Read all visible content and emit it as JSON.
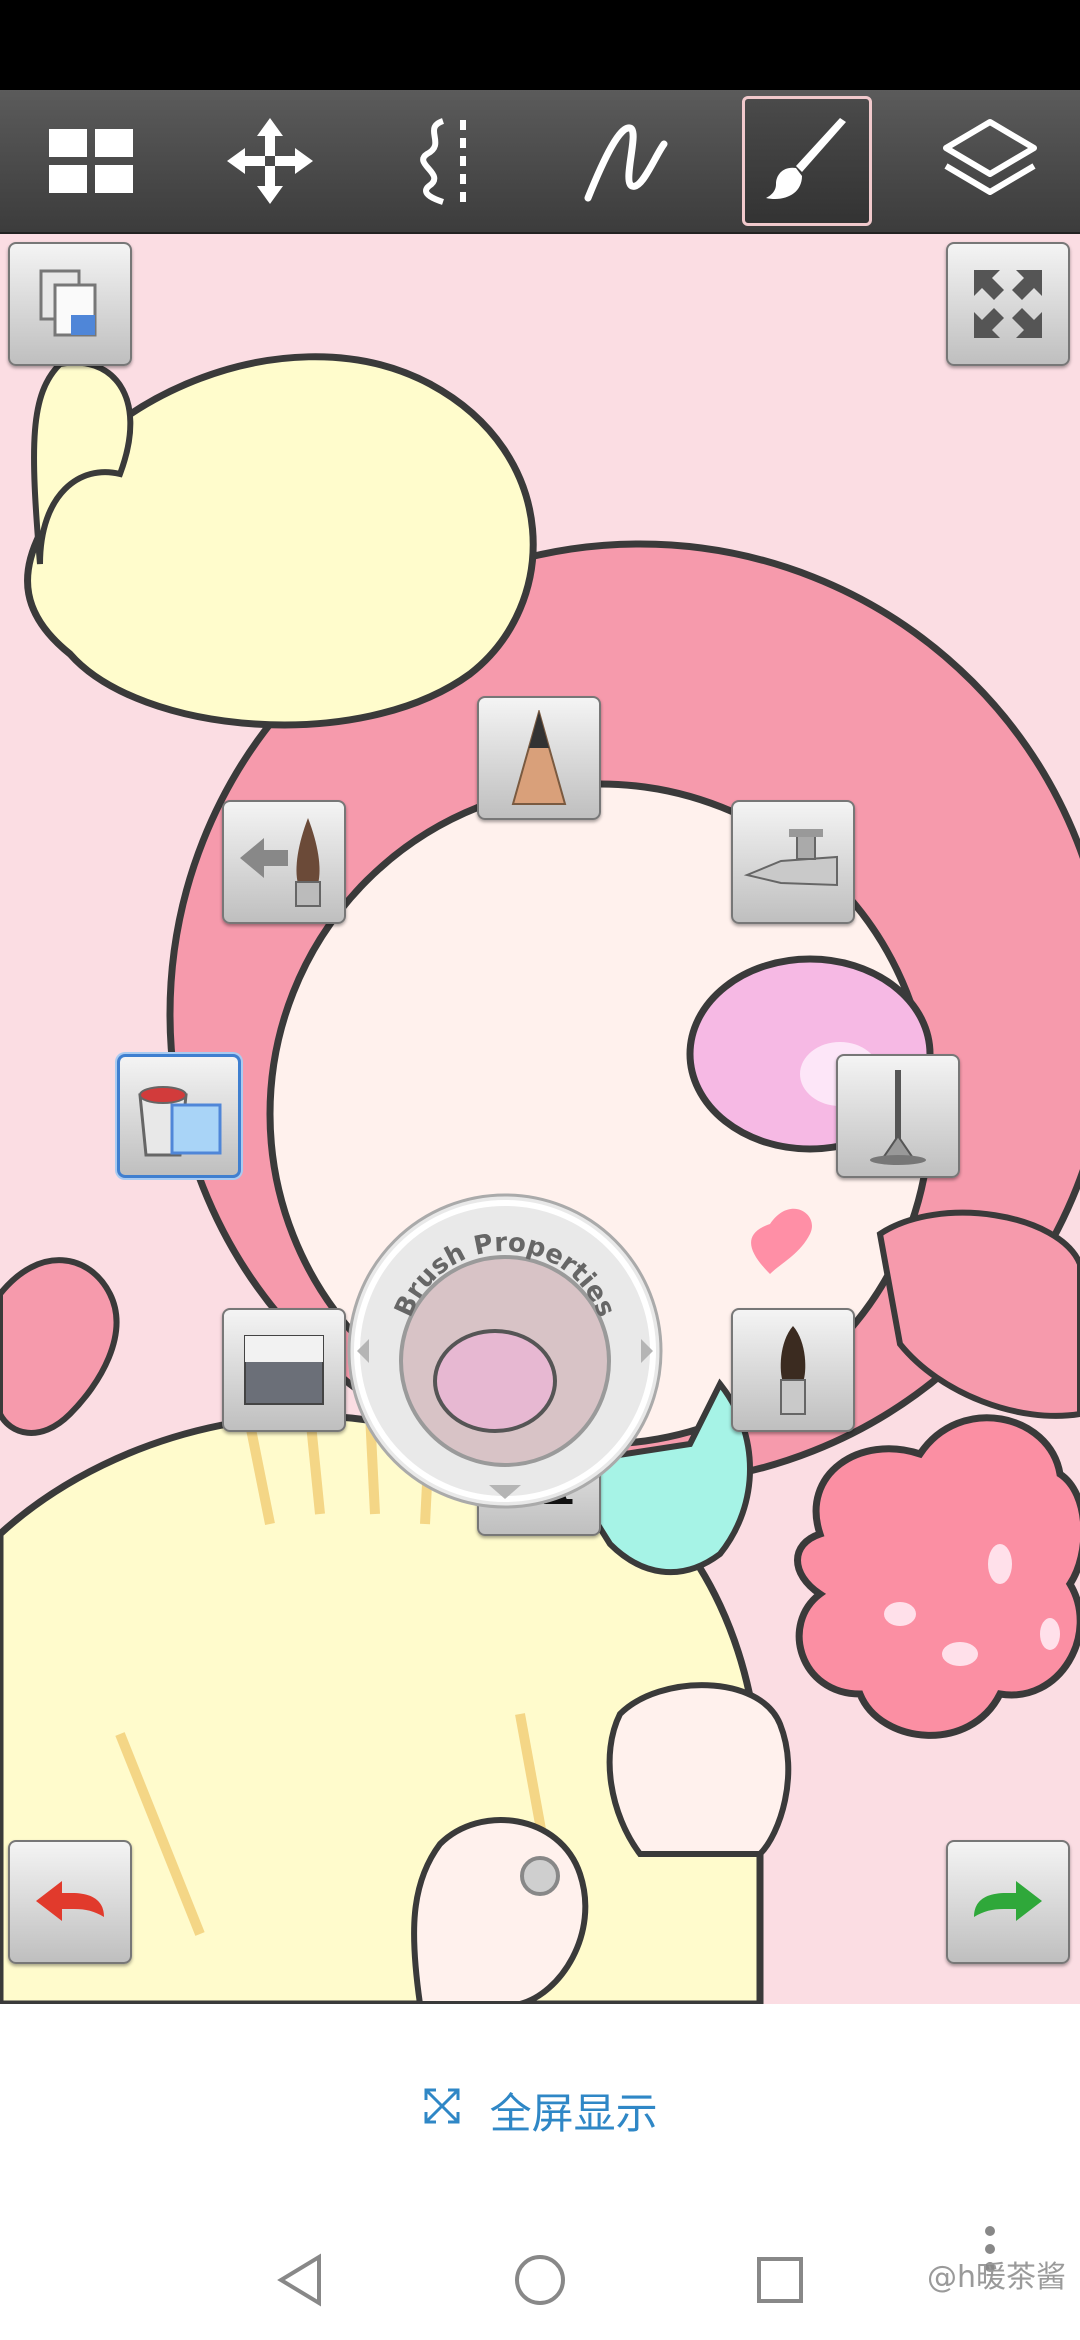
{
  "toolbar": {
    "tools": [
      {
        "icon": "grid-menu-icon"
      },
      {
        "icon": "move-arrows-icon"
      },
      {
        "icon": "symmetry-icon"
      },
      {
        "icon": "stroke-curve-icon"
      },
      {
        "icon": "paintbrush-icon",
        "active": true
      },
      {
        "icon": "layers-icon"
      }
    ]
  },
  "canvas": {
    "brush_ring_label": "Brush Properties",
    "brush_tools": [
      "pencil-icon",
      "airbrush-icon",
      "pen-nib-icon",
      "marker-icon",
      "brush-icon",
      "text-icon",
      "eraser-icon",
      "fill-bucket-icon",
      "smudge-brush-icon"
    ],
    "text_tool_glyph": "A"
  },
  "bottom": {
    "fullscreen_label": "全屏显示"
  },
  "watermark": "@h暖茶酱",
  "colors": {
    "accent": "#2f87c6",
    "canvas_bg": "#fbdde3",
    "toolbar": "#4a4a4a"
  }
}
